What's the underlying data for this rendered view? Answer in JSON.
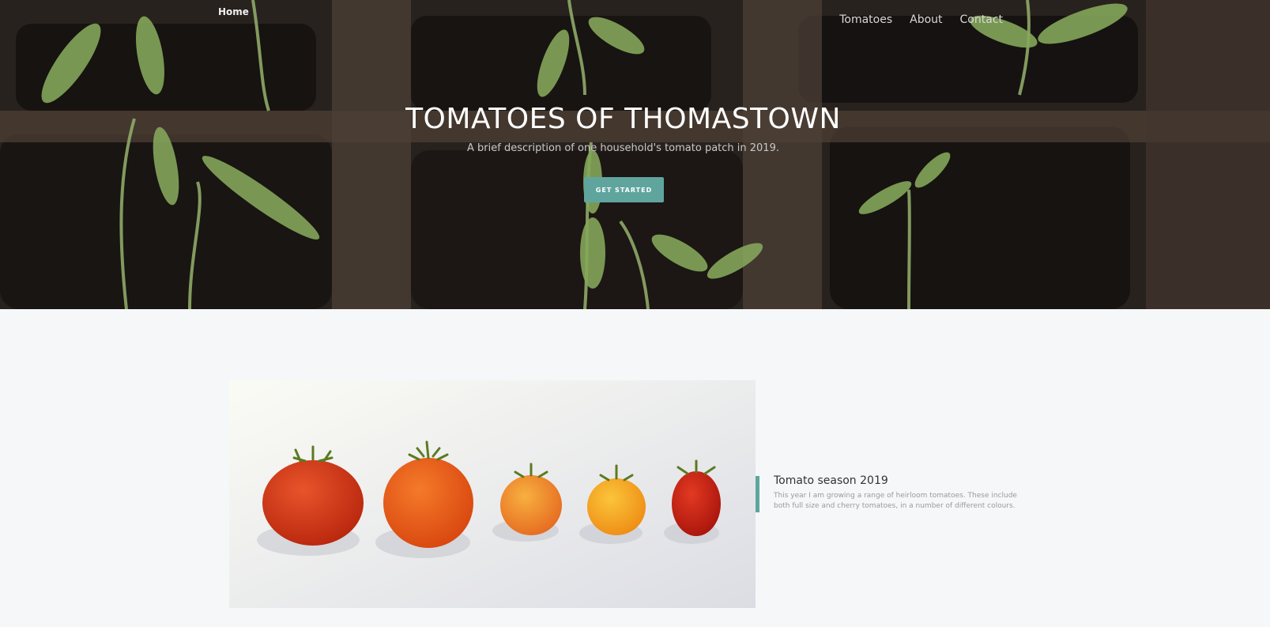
{
  "nav": {
    "home": "Home",
    "links": [
      "Tomatoes",
      "About",
      "Contact"
    ]
  },
  "hero": {
    "title": "TOMATOES OF THOMASTOWN",
    "subtitle": "A brief description of one household's tomato patch in 2019.",
    "cta": "GET STARTED"
  },
  "feature": {
    "title": "Tomato season 2019",
    "text": "This year I am growing a range of heirloom tomatoes. These include both full size and cherry tomatoes, in a number of different colours."
  },
  "colors": {
    "accent": "#5fa59e",
    "page_bg": "#f5f7f9"
  }
}
